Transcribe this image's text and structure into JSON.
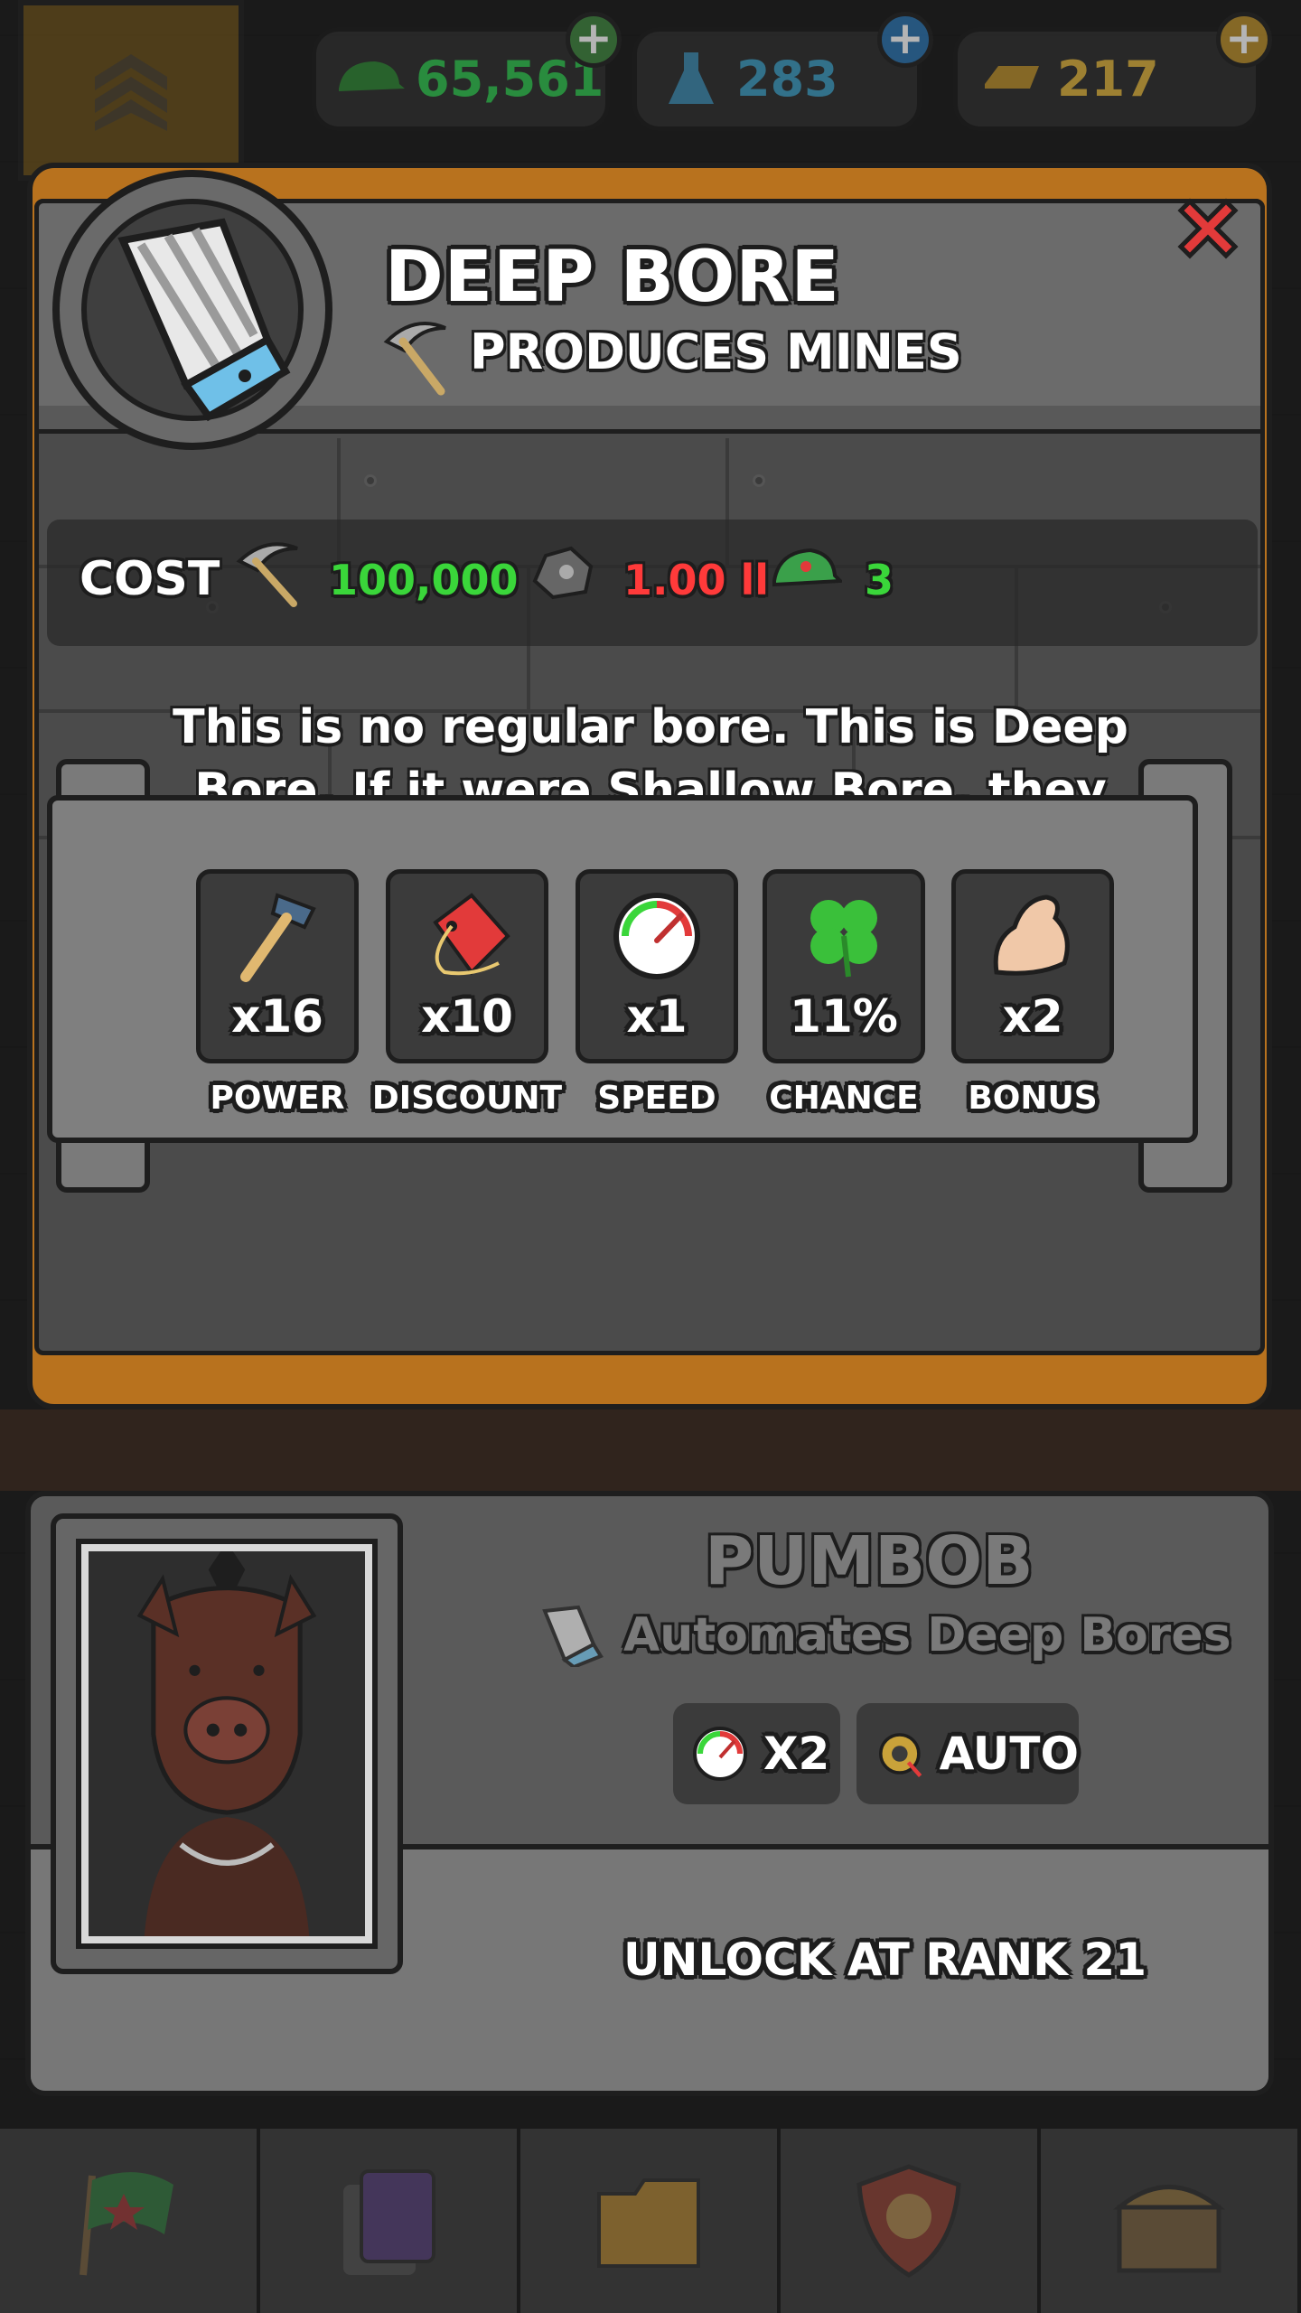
{
  "currencies": [
    {
      "name": "cash",
      "icon": "army-cap-icon",
      "value": "65,561",
      "color": "#2fb34a"
    },
    {
      "name": "research",
      "icon": "flask-icon",
      "value": "283",
      "color": "#3b8fb0"
    },
    {
      "name": "gold",
      "icon": "gold-bar-icon",
      "value": "217",
      "color": "#c9a23a"
    }
  ],
  "item": {
    "title": "DEEP BORE",
    "subtitle": "PRODUCES MINES",
    "description": "This is no regular bore. This is Deep Bore. If it were Shallow Bore, they would call it \"ditch\" or something."
  },
  "cost": {
    "label": "COST",
    "pickaxe_amount": "100,000",
    "ore_amount": "1.00 ll",
    "cap_amount": "3",
    "colors": {
      "ok": "#3ad63a",
      "insufficient": "#ff3a3a"
    }
  },
  "stats": [
    {
      "icon": "hammer-icon",
      "value": "x16",
      "label": "POWER"
    },
    {
      "icon": "price-tag-icon",
      "value": "x10",
      "label": "DISCOUNT"
    },
    {
      "icon": "speedometer-icon",
      "value": "x1",
      "label": "SPEED"
    },
    {
      "icon": "clover-icon",
      "value": "11%",
      "label": "CHANCE"
    },
    {
      "icon": "flexed-arm-icon",
      "value": "x2",
      "label": "BONUS"
    }
  ],
  "manager": {
    "name": "PUMBOB",
    "description": "Automates Deep Bores",
    "perks": [
      {
        "icon": "speedometer-icon",
        "label": "X2"
      },
      {
        "icon": "auto-gear-icon",
        "label": "AUTO"
      }
    ],
    "unlock_text": "UNLOCK AT RANK 21"
  },
  "nav": [
    "flag-icon",
    "cards-icon",
    "folder-icon",
    "shield-fist-icon",
    "treasure-chest-icon"
  ]
}
